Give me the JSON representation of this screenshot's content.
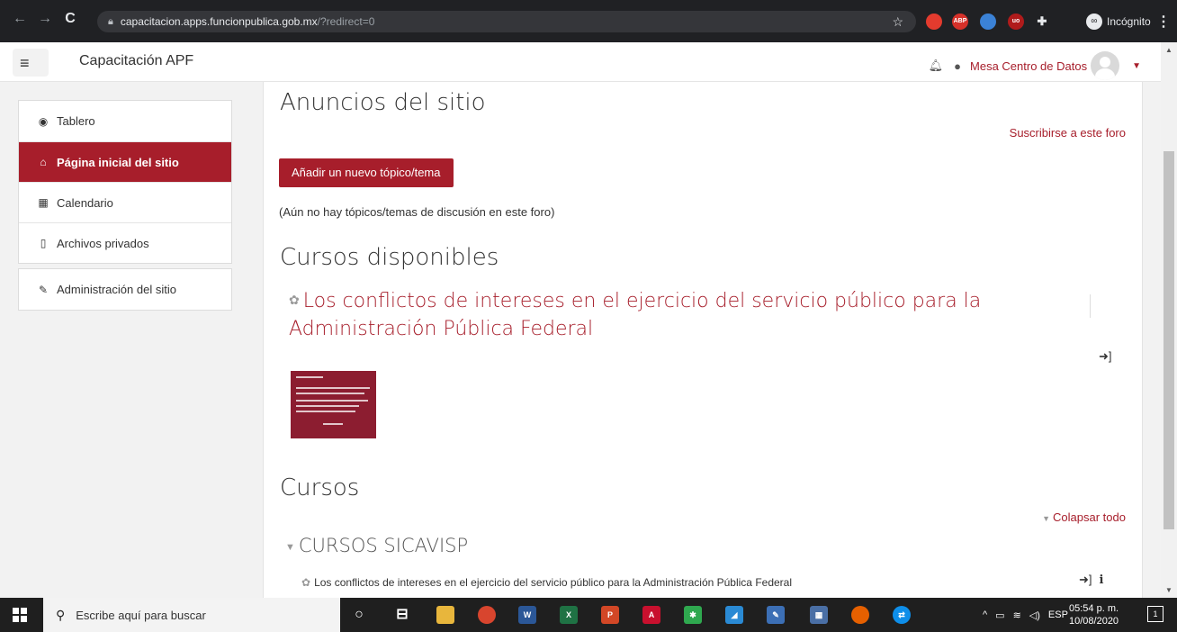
{
  "browser": {
    "url_host": "capacitacion.apps.funcionpublica.gob.mx",
    "url_path": "/?redirect=0",
    "incognito_label": "Incógnito",
    "extensions": [
      {
        "name": "shield-extension-icon",
        "color": "#e33b2e",
        "label": ""
      },
      {
        "name": "abp-extension-icon",
        "color": "#d6312a",
        "label": "ABP"
      },
      {
        "name": "blue-extension-icon",
        "color": "#3b82d6",
        "label": ""
      },
      {
        "name": "ublock-extension-icon",
        "color": "#b01b1b",
        "label": "uo"
      },
      {
        "name": "puzzle-extension-icon",
        "color": "#e8eaed",
        "label": ""
      }
    ]
  },
  "navbar": {
    "brand": "Capacitación APF",
    "user_name": "Mesa Centro de Datos"
  },
  "sidebar": {
    "groups": [
      [
        {
          "icon": "dashboard-icon",
          "glyph": "◉",
          "label": "Tablero",
          "active": false
        },
        {
          "icon": "home-icon",
          "glyph": "⌂",
          "label": "Página inicial del sitio",
          "active": true
        },
        {
          "icon": "calendar-icon",
          "glyph": "▦",
          "label": "Calendario",
          "active": false
        },
        {
          "icon": "file-icon",
          "glyph": "▯",
          "label": "Archivos privados",
          "active": false
        }
      ],
      [
        {
          "icon": "wrench-icon",
          "glyph": "✎",
          "label": "Administración del sitio",
          "active": false
        }
      ]
    ]
  },
  "main": {
    "announcements_title": "Anuncios del sitio",
    "subscribe_link": "Suscribirse a este foro",
    "add_topic_button": "Añadir un nuevo tópico/tema",
    "no_topics_text": "(Aún no hay tópicos/temas de discusión en este foro)",
    "available_courses_title": "Cursos disponibles",
    "featured_course": "Los conflictos de intereses en el ejercicio del servicio público para la Administración Pública Federal",
    "courses_title": "Cursos",
    "collapse_all": "Colapsar todo",
    "category_title": "CURSOS SICAVISP",
    "category_course": "Los conflictos de intereses en el ejercicio del servicio público para la Administración Pública Federal"
  },
  "taskbar": {
    "search_placeholder": "Escribe aquí para buscar",
    "language": "ESP",
    "time": "05:54 p. m.",
    "date": "10/08/2020",
    "notification_count": "1",
    "apps": [
      {
        "name": "cortana-icon",
        "color": "transparent",
        "glyph": "○"
      },
      {
        "name": "task-view-icon",
        "color": "transparent",
        "glyph": "⊟"
      },
      {
        "name": "file-explorer-icon",
        "color": "#e8b63c",
        "glyph": ""
      },
      {
        "name": "chrome-icon",
        "color": "#d8452e",
        "glyph": ""
      },
      {
        "name": "word-icon",
        "color": "#2b5797",
        "glyph": "W"
      },
      {
        "name": "excel-icon",
        "color": "#1f7244",
        "glyph": "X"
      },
      {
        "name": "powerpoint-icon",
        "color": "#d24726",
        "glyph": "P"
      },
      {
        "name": "acrobat-icon",
        "color": "#c8102e",
        "glyph": "A"
      },
      {
        "name": "green-app-icon",
        "color": "#2fa84f",
        "glyph": "✱"
      },
      {
        "name": "blue-app-icon",
        "color": "#2a8ad4",
        "glyph": "◢"
      },
      {
        "name": "paint-icon",
        "color": "#3c6fb5",
        "glyph": "✎"
      },
      {
        "name": "calculator-icon",
        "color": "#4a6fa5",
        "glyph": "▦"
      },
      {
        "name": "firefox-icon",
        "color": "#e66000",
        "glyph": ""
      },
      {
        "name": "teamviewer-icon",
        "color": "#0e8ee9",
        "glyph": "⇄"
      }
    ]
  }
}
